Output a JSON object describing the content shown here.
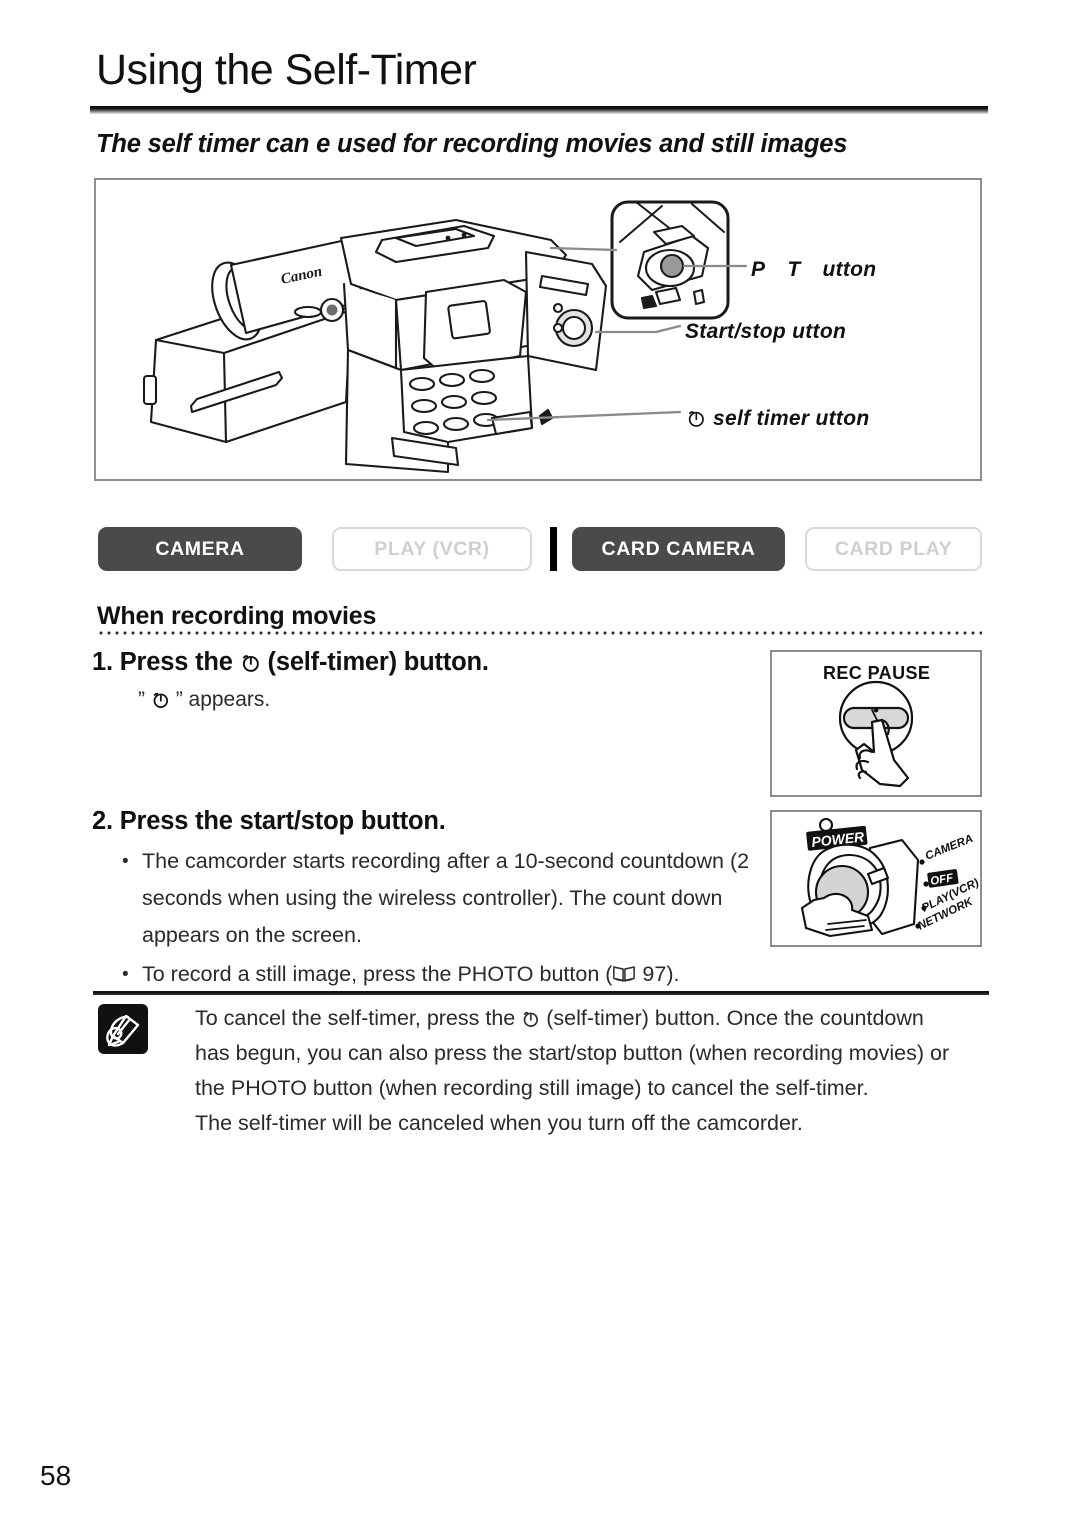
{
  "header": {
    "title": "Using the Self-Timer",
    "subtitle": "The self timer can  e used for recording movies and still images"
  },
  "illustration": {
    "brand": "Canon",
    "callouts": [
      {
        "name": "photo-button",
        "text_before": "P",
        "text_mid": "T",
        "text_after": "utton"
      },
      {
        "name": "start-stop-button",
        "text": "Start/stop  utton"
      },
      {
        "name": "self-timer-button",
        "text": "self timer   utton"
      }
    ]
  },
  "mode_tabs": [
    {
      "label": "CAMERA",
      "state": "active"
    },
    {
      "label": "PLAY (VCR)",
      "state": "inactive"
    },
    {
      "label": "CARD CAMERA",
      "state": "active"
    },
    {
      "label": "CARD PLAY",
      "state": "inactive"
    }
  ],
  "section": {
    "heading": "When recording movies"
  },
  "steps": [
    {
      "heading_prefix": "1. Press the",
      "heading_suffix": "(self-timer) button.",
      "sub_prefix": "”",
      "sub_suffix": "” appears."
    },
    {
      "heading": "2. Press the start/stop button.",
      "bullets": [
        "The camcorder starts recording after a 10-second countdown (2 seconds when using the wireless controller). The count down appears on the screen.",
        "To record a still image, press the PHOTO button (",
        "97)."
      ]
    }
  ],
  "figures": {
    "rec_pause": {
      "label": "REC PAUSE"
    },
    "power_dial": {
      "label": "POWER",
      "positions": [
        "CAMERA",
        "OFF",
        "PLAY(VCR)",
        "NETWORK"
      ]
    }
  },
  "note": {
    "lines": [
      "To cancel the self-timer, press the",
      "(self-timer) button. Once the countdown",
      "has begun, you can also press the start/stop button (when recording movies) or",
      "the PHOTO button (when recording still image) to cancel the self-timer.",
      "The self-timer will be canceled when you turn off the camcorder."
    ]
  },
  "footer": {
    "page_number": "58"
  },
  "colors": {
    "tab_active_bg": "#4a4a4a",
    "tab_inactive_text": "#cfcfcf",
    "rule": "#111111",
    "border": "#8d8d8d"
  }
}
